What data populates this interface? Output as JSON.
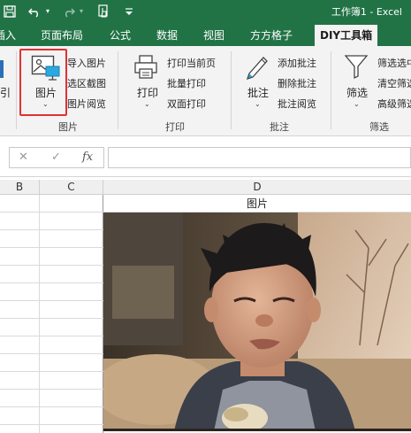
{
  "title_bar": {
    "title": "工作簿1  -  Excel",
    "quick_access": [
      "save-icon",
      "undo-icon",
      "redo-icon",
      "touch-mode-icon",
      "customize-icon"
    ]
  },
  "tabs": [
    {
      "label": "插入"
    },
    {
      "label": "页面布局"
    },
    {
      "label": "公式"
    },
    {
      "label": "数据"
    },
    {
      "label": "视图"
    },
    {
      "label": "方方格子"
    },
    {
      "label": "DIY工具箱",
      "active": true
    }
  ],
  "ribbon": {
    "left_partial_label": "引",
    "picture_group": {
      "big_button": "图片",
      "items": [
        "导入图片",
        "选区截图",
        "图片阅览"
      ],
      "group_label": "图片"
    },
    "print_group": {
      "big_button": "打印",
      "items": [
        "打印当前页",
        "批量打印",
        "双面打印"
      ],
      "group_label": "打印"
    },
    "comment_group": {
      "big_button": "批注",
      "items": [
        "添加批注",
        "删除批注",
        "批注阅览"
      ],
      "group_label": "批注"
    },
    "filter_group": {
      "big_button": "筛选",
      "items": [
        "筛选选中",
        "清空筛选",
        "高级筛选"
      ],
      "group_label": "筛选"
    }
  },
  "formula_bar": {
    "cancel": "✕",
    "enter": "✓",
    "fx": "fx",
    "value": ""
  },
  "columns": [
    "B",
    "C",
    "D"
  ],
  "cells": {
    "D1": "图片"
  },
  "colors": {
    "excel_green": "#217346",
    "ribbon_bg": "#f3f3f3",
    "selection_red": "#e03131"
  }
}
